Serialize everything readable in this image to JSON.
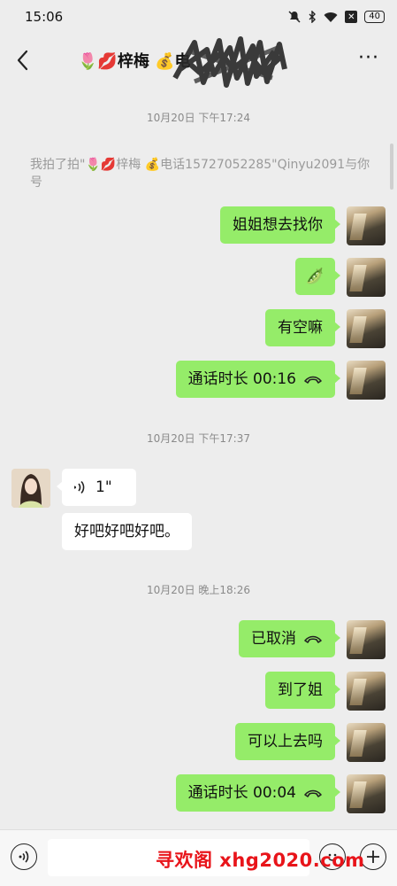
{
  "status_bar": {
    "time": "15:06",
    "battery": "40",
    "icons": [
      "mute-bell-icon",
      "bluetooth-icon",
      "wifi-icon",
      "close-box-icon",
      "battery-icon"
    ]
  },
  "header": {
    "title": "🌷💋梓梅 💰电",
    "back_icon": "chevron-left-icon",
    "more_label": "···"
  },
  "chat": {
    "timestamps": [
      "10月20日 下午17:24",
      "10月20日 下午17:37",
      "10月20日 晚上18:26"
    ],
    "system_message": "我拍了拍\"🌷💋梓梅 💰电话15727052285\"Qinyu2091与你号",
    "messages": [
      {
        "from": "me",
        "text": "姐姐想去找你"
      },
      {
        "from": "me",
        "text": "🫛"
      },
      {
        "from": "me",
        "text": "有空嘛"
      },
      {
        "from": "me",
        "text": "通话时长 00:16",
        "type": "call"
      },
      {
        "from": "her",
        "text": "1\"",
        "type": "voice"
      },
      {
        "from": "her",
        "text": "好吧好吧好吧。"
      },
      {
        "from": "me",
        "text": "已取消",
        "type": "call"
      },
      {
        "from": "me",
        "text": "到了姐"
      },
      {
        "from": "me",
        "text": "可以上去吗"
      },
      {
        "from": "me",
        "text": "通话时长 00:04",
        "type": "call"
      }
    ]
  },
  "input_bar": {
    "placeholder": "",
    "left_icon": "voice-toggle-icon",
    "emoji_icon": "emoji-icon",
    "plus_icon": "plus-icon"
  },
  "watermark": "寻欢阁 xhg2020.com",
  "colors": {
    "background": "#ededed",
    "my_bubble": "#95ec69",
    "her_bubble": "#ffffff",
    "watermark": "#e8141a"
  }
}
